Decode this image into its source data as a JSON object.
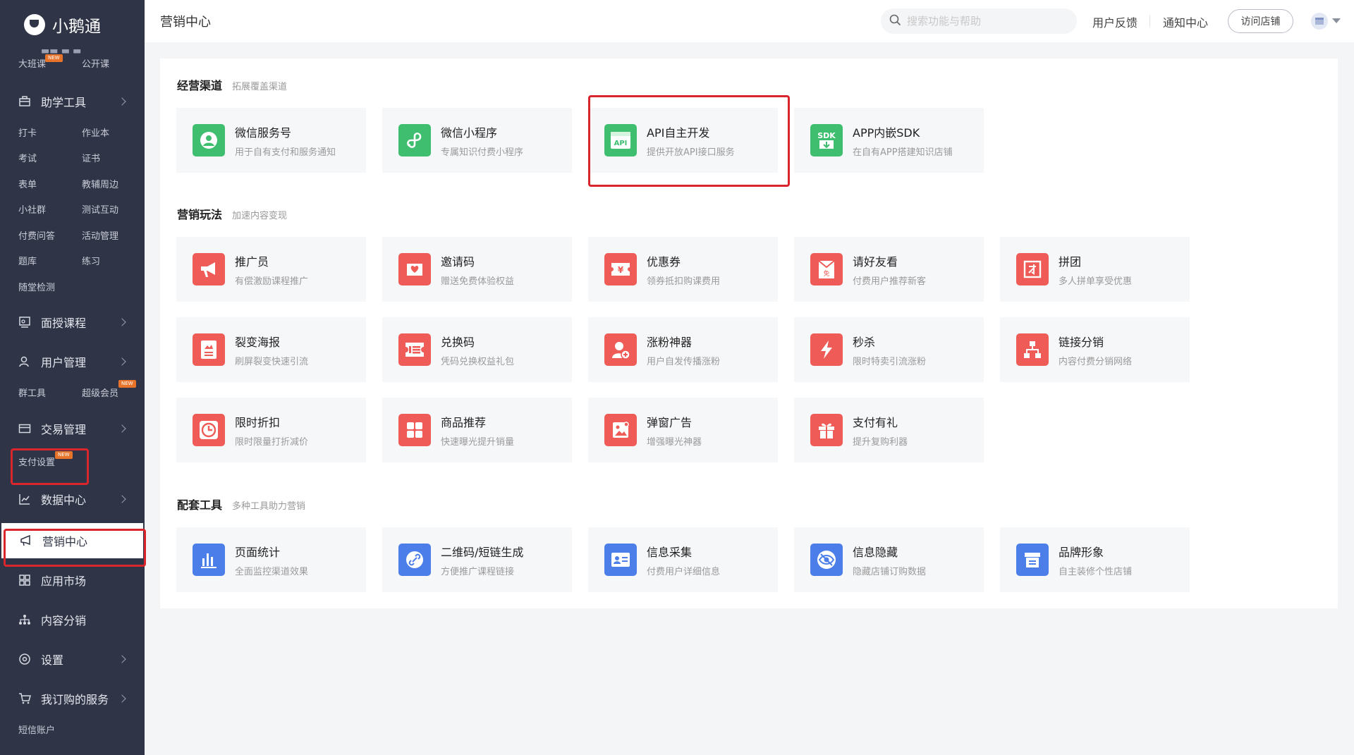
{
  "sidebar": {
    "logo": "小鹅通",
    "top_items": [
      {
        "label": "大班课",
        "new": "NEW"
      },
      {
        "label": "公开课"
      }
    ],
    "nav": [
      {
        "label": "助学工具",
        "icon": "briefcase-icon",
        "has_children": true,
        "children": [
          "打卡",
          "作业本",
          "考试",
          "证书",
          "表单",
          "教辅周边",
          "小社群",
          "测试互动",
          "付费问答",
          "活动管理",
          "题库",
          "练习",
          "随堂检测"
        ]
      },
      {
        "label": "面授课程",
        "icon": "classroom-icon",
        "has_children": true,
        "children": []
      },
      {
        "label": "用户管理",
        "icon": "user-icon",
        "has_children": true,
        "children": [
          "群工具",
          "超级会员"
        ],
        "new_on": "超级会员"
      },
      {
        "label": "交易管理",
        "icon": "card-icon",
        "has_children": true,
        "children": [
          "支付设置"
        ],
        "new_on": "支付设置"
      },
      {
        "label": "数据中心",
        "icon": "chart-icon",
        "has_children": true,
        "children": []
      },
      {
        "label": "营销中心",
        "icon": "megaphone-icon",
        "has_children": false,
        "active": true,
        "children": []
      },
      {
        "label": "应用市场",
        "icon": "apps-icon",
        "has_children": false,
        "children": []
      },
      {
        "label": "内容分销",
        "icon": "network-icon",
        "has_children": false,
        "children": []
      },
      {
        "label": "设置",
        "icon": "settings-icon",
        "has_children": true,
        "children": []
      },
      {
        "label": "我订购的服务",
        "icon": "cart-icon",
        "has_children": true,
        "children": [
          "短信账户"
        ]
      }
    ],
    "new_badge": "NEW"
  },
  "header": {
    "title": "营销中心",
    "search_placeholder": "搜索功能与帮助",
    "feedback": "用户反馈",
    "notifications": "通知中心",
    "visit_store": "访问店铺"
  },
  "sections": [
    {
      "title": "经营渠道",
      "subtitle": "拓展覆盖渠道",
      "cards": [
        {
          "name": "微信服务号",
          "desc": "用于自有支付和服务通知",
          "color": "#3ebe6e",
          "icon": "wechat-service-icon"
        },
        {
          "name": "微信小程序",
          "desc": "专属知识付费小程序",
          "color": "#3ebe6e",
          "icon": "mini-program-icon"
        },
        {
          "name": "API自主开发",
          "desc": "提供开放API接口服务",
          "color": "#3ebe6e",
          "icon": "api-icon",
          "highlighted": true
        },
        {
          "name": "APP内嵌SDK",
          "desc": "在自有APP搭建知识店铺",
          "color": "#3ebe6e",
          "icon": "sdk-icon"
        }
      ]
    },
    {
      "title": "营销玩法",
      "subtitle": "加速内容变现",
      "cards": [
        {
          "name": "推广员",
          "desc": "有偿激励课程推广",
          "color": "#ef5c57",
          "icon": "megaphone-icon"
        },
        {
          "name": "邀请码",
          "desc": "赠送免费体验权益",
          "color": "#ef5c57",
          "icon": "heart-envelope-icon"
        },
        {
          "name": "优惠券",
          "desc": "领券抵扣购课费用",
          "color": "#ef5c57",
          "icon": "coupon-icon"
        },
        {
          "name": "请好友看",
          "desc": "付费用户推荐新客",
          "color": "#ef5c57",
          "icon": "free-envelope-icon"
        },
        {
          "name": "拼团",
          "desc": "多人拼单享受优惠",
          "color": "#ef5c57",
          "icon": "group-buy-icon"
        },
        {
          "name": "裂变海报",
          "desc": "刷屏裂变快速引流",
          "color": "#ef5c57",
          "icon": "poster-icon"
        },
        {
          "name": "兑换码",
          "desc": "凭码兑换权益礼包",
          "color": "#ef5c57",
          "icon": "redeem-code-icon"
        },
        {
          "name": "涨粉神器",
          "desc": "用户自发传播涨粉",
          "color": "#ef5c57",
          "icon": "add-user-icon"
        },
        {
          "name": "秒杀",
          "desc": "限时特卖引流涨粉",
          "color": "#ef5c57",
          "icon": "lightning-icon"
        },
        {
          "name": "链接分销",
          "desc": "内容付费分销网络",
          "color": "#ef5c57",
          "icon": "distribution-icon"
        },
        {
          "name": "限时折扣",
          "desc": "限时限量打折减价",
          "color": "#ef5c57",
          "icon": "clock-icon"
        },
        {
          "name": "商品推荐",
          "desc": "快速曝光提升销量",
          "color": "#ef5c57",
          "icon": "grid-icon"
        },
        {
          "name": "弹窗广告",
          "desc": "增强曝光神器",
          "color": "#ef5c57",
          "icon": "popup-ad-icon"
        },
        {
          "name": "支付有礼",
          "desc": "提升复购利器",
          "color": "#ef5c57",
          "icon": "gift-icon"
        }
      ]
    },
    {
      "title": "配套工具",
      "subtitle": "多种工具助力营销",
      "cards": [
        {
          "name": "页面统计",
          "desc": "全面监控渠道效果",
          "color": "#4b7ee8",
          "icon": "bar-chart-icon"
        },
        {
          "name": "二维码/短链生成",
          "desc": "方便推广课程链接",
          "color": "#4b7ee8",
          "icon": "link-icon"
        },
        {
          "name": "信息采集",
          "desc": "付费用户详细信息",
          "color": "#4b7ee8",
          "icon": "id-card-icon"
        },
        {
          "name": "信息隐藏",
          "desc": "隐藏店铺订购数据",
          "color": "#4b7ee8",
          "icon": "eye-hidden-icon"
        },
        {
          "name": "品牌形象",
          "desc": "自主装修个性店铺",
          "color": "#4b7ee8",
          "icon": "storefront-icon"
        }
      ]
    }
  ]
}
